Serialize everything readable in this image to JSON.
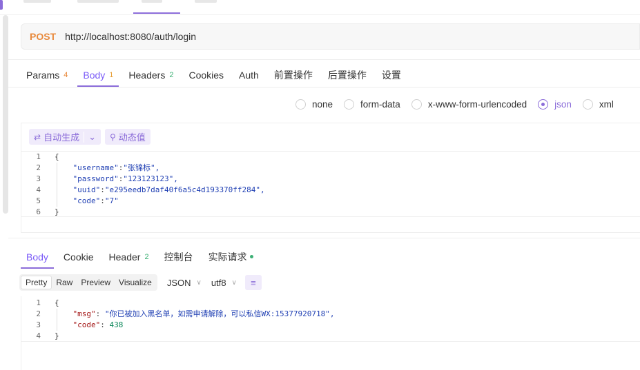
{
  "request": {
    "method": "POST",
    "url": "http://localhost:8080/auth/login"
  },
  "request_tabs": [
    {
      "label": "Params",
      "badge": "4"
    },
    {
      "label": "Body",
      "badge": "1"
    },
    {
      "label": "Headers",
      "badge": "2"
    },
    {
      "label": "Cookies"
    },
    {
      "label": "Auth"
    },
    {
      "label": "前置操作"
    },
    {
      "label": "后置操作"
    },
    {
      "label": "设置"
    }
  ],
  "body_types": [
    {
      "label": "none"
    },
    {
      "label": "form-data"
    },
    {
      "label": "x-www-form-urlencoded"
    },
    {
      "label": "json",
      "selected": true
    },
    {
      "label": "xml"
    }
  ],
  "editor_toolbar": {
    "auto_generate": "自动生成",
    "dynamic_value": "动态值"
  },
  "request_body_lines": [
    {
      "num": "1",
      "text": "{"
    },
    {
      "num": "2",
      "key": "\"username\"",
      "value": "\"张锦标\","
    },
    {
      "num": "3",
      "key": "\"password\"",
      "value": "\"123123123\","
    },
    {
      "num": "4",
      "key": "\"uuid\"",
      "value": "\"e295eedb7daf40f6a5c4d193370ff284\","
    },
    {
      "num": "5",
      "key": "\"code\"",
      "value": "\"7\""
    },
    {
      "num": "6",
      "text": "}"
    }
  ],
  "response_tabs": [
    {
      "label": "Body"
    },
    {
      "label": "Cookie"
    },
    {
      "label": "Header",
      "badge": "2"
    },
    {
      "label": "控制台"
    },
    {
      "label": "实际请求"
    }
  ],
  "response_toolbar": {
    "views": [
      "Pretty",
      "Raw",
      "Preview",
      "Visualize"
    ],
    "format": "JSON",
    "encoding": "utf8"
  },
  "response_body_lines": [
    {
      "num": "1",
      "text": "{"
    },
    {
      "num": "2",
      "key": "\"msg\"",
      "value": "\"你已被加入黑名单，如需申请解除，可以私信WX:15377920718\","
    },
    {
      "num": "3",
      "key": "\"code\"",
      "value": "438"
    },
    {
      "num": "4",
      "text": "}"
    }
  ],
  "colors": {
    "accent": "#8b6cd9",
    "method": "#e8893b",
    "status_dot": "#3db075"
  }
}
